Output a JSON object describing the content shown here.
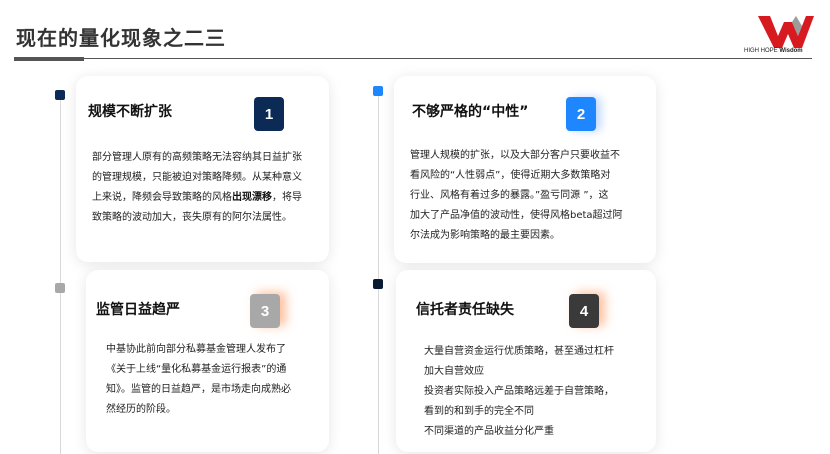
{
  "slide": {
    "title": "现在的量化现象之二三",
    "logo": {
      "brand_text": "HIGH HOPE",
      "brand_bold": "Wisdom"
    }
  },
  "colors": {
    "navy": "#0b2a55",
    "blue": "#1e86ff",
    "gray": "#a8a8a8",
    "dark": "#3a3a3a"
  },
  "cards": [
    {
      "title": "规模不断扩张",
      "number": "1",
      "lines": [
        "部分管理人原有的高频策略无法容纳其日益扩张",
        "的管理规模，只能被迫对策略降频。从某种意义",
        [
          "上来说，降频会导致策略的风格",
          "出现漂移",
          "，将导"
        ],
        "致策略的波动加大，丧失原有的阿尔法属性。"
      ]
    },
    {
      "title": "不够严格的“中性”",
      "number": "2",
      "lines": [
        "管理人规模的扩张，以及大部分客户只要收益不",
        "看风险的“人性弱点”，使得近期大多数策略对",
        "行业、风格有着过多的暴露。”盈亏同源 ”，这",
        "加大了产品净值的波动性，使得风格beta超过阿",
        "尔法成为影响策略的最主要因素。"
      ]
    },
    {
      "title": "监管日益趋严",
      "number": "3",
      "lines": [
        "中基协此前向部分私募基金管理人发布了",
        "《关于上线“量化私募基金运行报表”的通",
        "知》。监管的日益趋严，是市场走向成熟必",
        "然经历的阶段。"
      ]
    },
    {
      "title": "信托者责任缺失",
      "number": "4",
      "lines": [
        "大量自营资金运行优质策略，甚至通过杠杆",
        "加大自营效应",
        "投资者实际投入产品策略远差于自营策略，",
        "看到的和到手的完全不同",
        "不同渠道的产品收益分化严重"
      ]
    }
  ]
}
